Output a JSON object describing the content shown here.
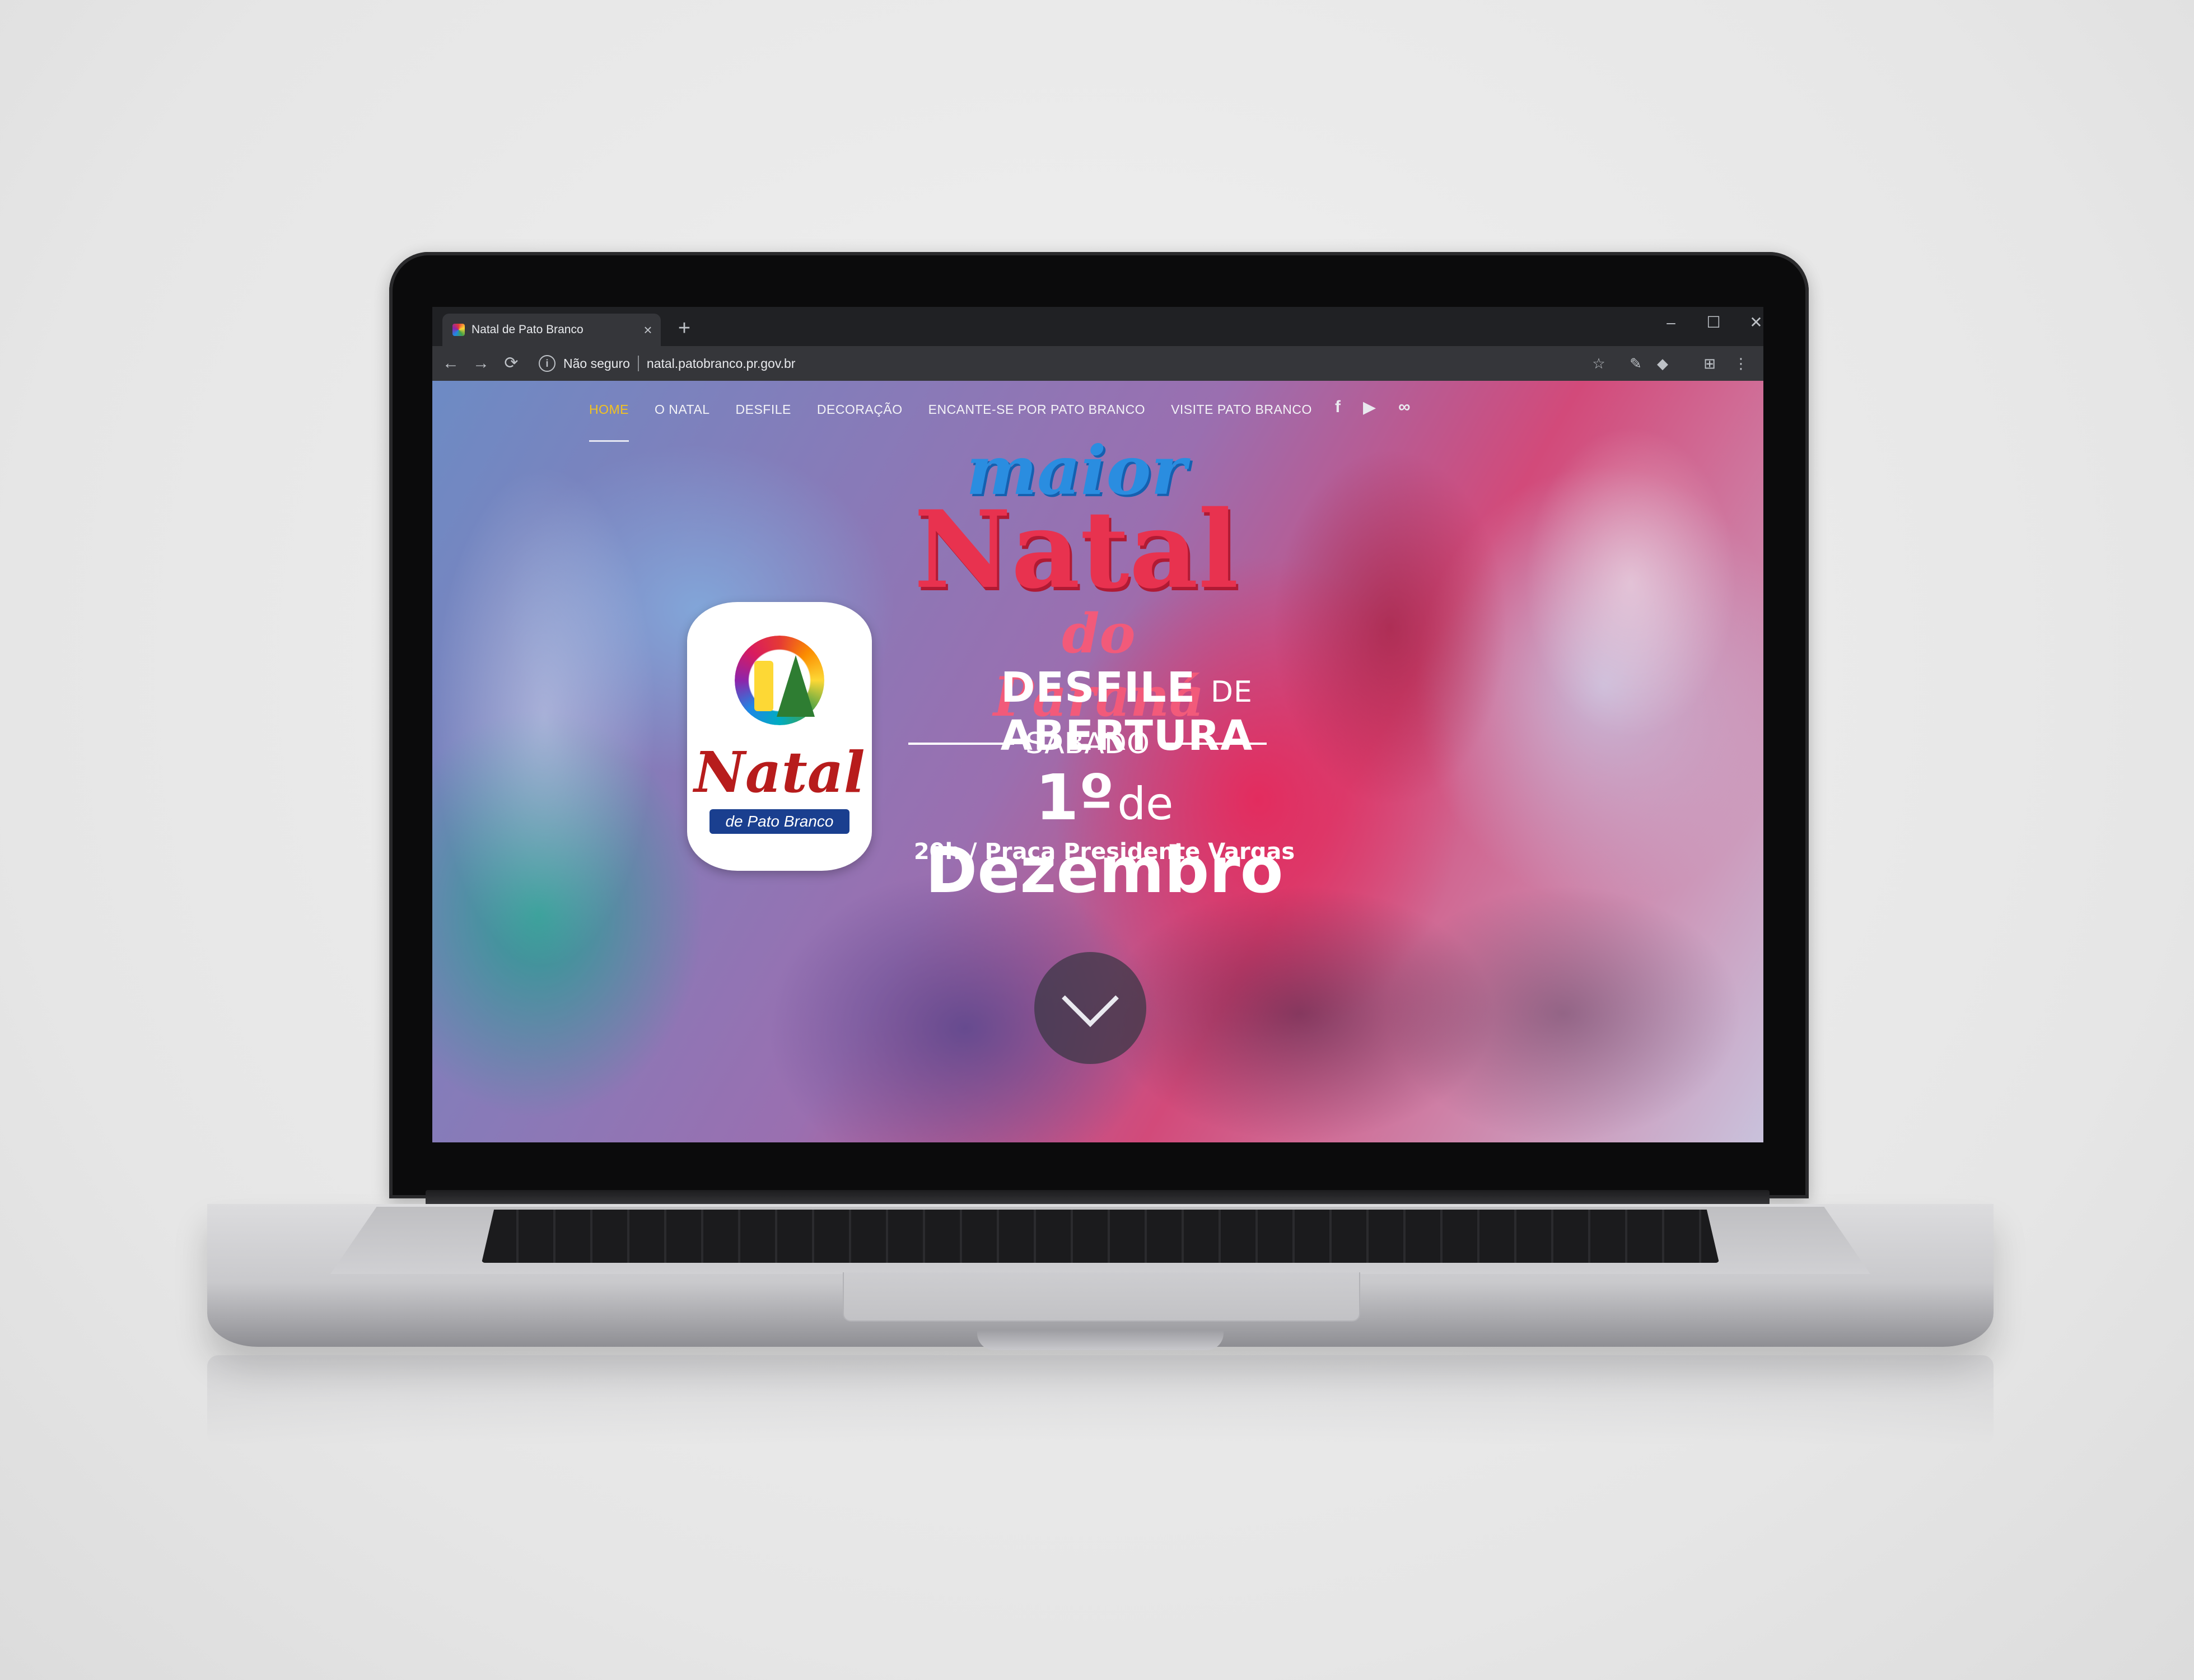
{
  "browser": {
    "tab_title": "Natal de Pato Branco",
    "tab_close": "×",
    "new_tab": "+",
    "window_minimize": "–",
    "window_maximize": "☐",
    "window_close": "✕",
    "back": "←",
    "forward": "→",
    "reload": "⟳",
    "security_label": "Não seguro",
    "url": "natal.patobranco.pr.gov.br",
    "bookmark_star": "☆",
    "menu": "⋮"
  },
  "nav": {
    "items": [
      {
        "label": "HOME",
        "active": true
      },
      {
        "label": "O NATAL"
      },
      {
        "label": "DESFILE"
      },
      {
        "label": "DECORAÇÃO"
      },
      {
        "label": "ENCANTE-SE POR PATO BRANCO"
      },
      {
        "label": "VISITE PATO BRANCO"
      }
    ],
    "social": [
      "f",
      "▶",
      "∞"
    ]
  },
  "hero": {
    "word_maior": "maior",
    "word_natal": "Natal",
    "word_parana": "do Paraná",
    "desfile_1": "DESFILE",
    "desfile_de": "DE",
    "desfile_2": "ABERTURA",
    "day": "SÁBADO",
    "date_num": "1º",
    "date_de": "de",
    "date_month": "Dezembro",
    "place": "20h / Praça Presidente Vargas"
  },
  "logo": {
    "natal": "Natal",
    "subtitle": "de Pato Branco"
  },
  "colors": {
    "nav_active": "#f3c21f",
    "natal_red": "#e8324f",
    "maior_blue": "#2a8de0"
  }
}
